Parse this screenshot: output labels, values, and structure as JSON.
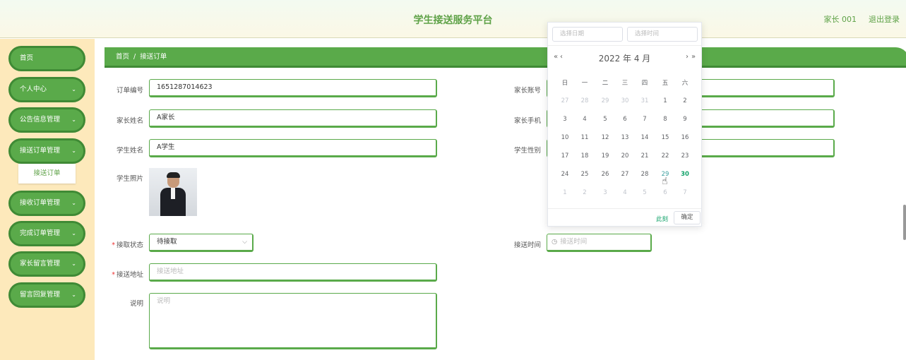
{
  "header": {
    "title": "学生接送服务平台",
    "user": "家长 001",
    "logout": "退出登录"
  },
  "menu": [
    {
      "label": "首页",
      "chev": ""
    },
    {
      "label": "个人中心",
      "chev": "⌄"
    },
    {
      "label": "公告信息管理",
      "chev": "⌄"
    },
    {
      "label": "接送订单管理",
      "chev": "⌄"
    },
    {
      "label": "接收订单管理",
      "chev": "⌄"
    },
    {
      "label": "完成订单管理",
      "chev": "⌄"
    },
    {
      "label": "家长留言管理",
      "chev": "⌄"
    },
    {
      "label": "留言回复管理",
      "chev": "⌄"
    }
  ],
  "submenu": {
    "label": "接送订单"
  },
  "breadcrumb": {
    "home": "首页",
    "sep": "/",
    "current": "接送订单"
  },
  "form": {
    "order_no": {
      "label": "订单编号",
      "value": "1651287014623"
    },
    "parent_account": {
      "label": "家长账号",
      "value": ""
    },
    "parent_name": {
      "label": "家长姓名",
      "value": "A家长"
    },
    "parent_phone": {
      "label": "家长手机",
      "value": ""
    },
    "student_name": {
      "label": "学生姓名",
      "value": "A学生"
    },
    "student_gender": {
      "label": "学生性别",
      "value": ""
    },
    "student_photo": {
      "label": "学生照片"
    },
    "status": {
      "label": "接取状态",
      "value": "待接取",
      "required": "*"
    },
    "pickup_time": {
      "label": "接送时间",
      "placeholder": "接送时间"
    },
    "address": {
      "label": "接送地址",
      "placeholder": "接送地址",
      "required": "*"
    },
    "note": {
      "label": "说明",
      "placeholder": "说明"
    }
  },
  "picker": {
    "date_placeholder": "选择日期",
    "time_placeholder": "选择时间",
    "year_month": "2022 年  4 月",
    "prev_year": "«",
    "prev_month": "‹",
    "next_month": "›",
    "next_year": "»",
    "weekdays": [
      "日",
      "一",
      "二",
      "三",
      "四",
      "五",
      "六"
    ],
    "days": [
      [
        "27",
        "28",
        "29",
        "30",
        "31",
        "1",
        "2"
      ],
      [
        "3",
        "4",
        "5",
        "6",
        "7",
        "8",
        "9"
      ],
      [
        "10",
        "11",
        "12",
        "13",
        "14",
        "15",
        "16"
      ],
      [
        "17",
        "18",
        "19",
        "20",
        "21",
        "22",
        "23"
      ],
      [
        "24",
        "25",
        "26",
        "27",
        "28",
        "29",
        "30"
      ],
      [
        "1",
        "2",
        "3",
        "4",
        "5",
        "6",
        "7"
      ]
    ],
    "now": "此刻",
    "confirm": "确定"
  }
}
